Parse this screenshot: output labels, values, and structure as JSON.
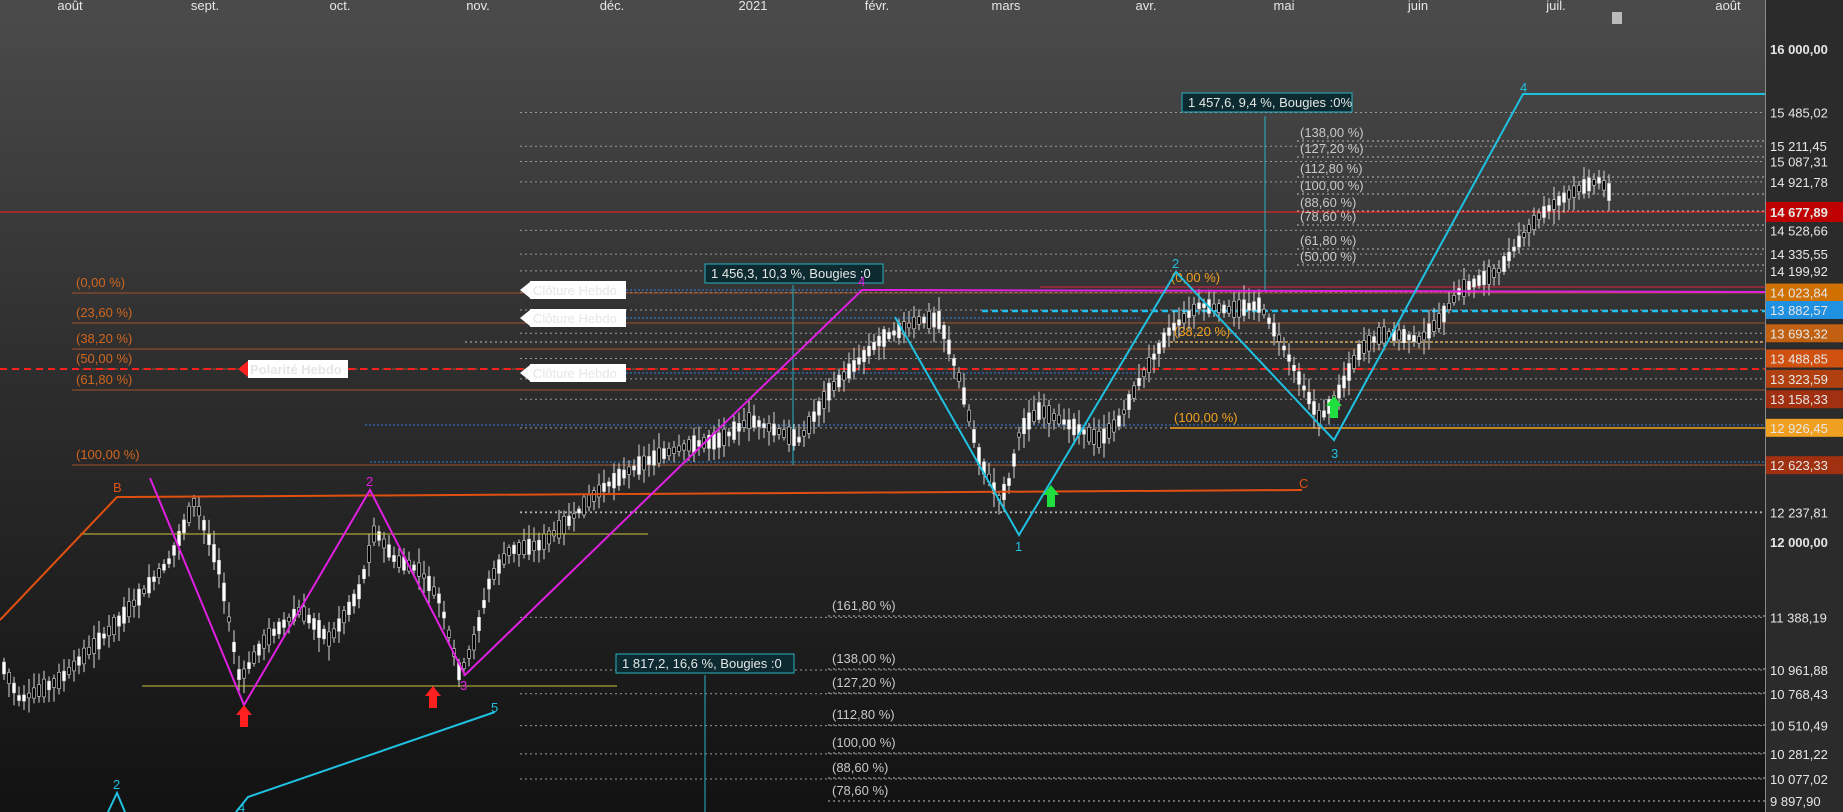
{
  "chart_data": {
    "type": "candlestick",
    "x_ticks": [
      "août",
      "sept.",
      "oct.",
      "nov.",
      "déc.",
      "2021",
      "févr.",
      "mars",
      "avr.",
      "mai",
      "juin",
      "juil.",
      "août"
    ],
    "price_axis_labels": [
      "16 000,00",
      "15 485,02",
      "15 211,45",
      "15 087,31",
      "14 921,78",
      "14 528,66",
      "14 335,55",
      "14 199,92",
      "14 023,84",
      "13 882,57",
      "13 693,32",
      "13 488,85",
      "13 323,59",
      "13 158,33",
      "12 926,45",
      "12 623,33",
      "12 237,81",
      "12 000,00",
      "11 388,19",
      "10 961,88",
      "10 768,43",
      "10 510,49",
      "10 281,22",
      "10 077,02",
      "9 897,90"
    ],
    "current_price": "14 677,89",
    "weekly_close_label": "Clôture Hebdo",
    "weekly_polarity_label": "Polarité Hebdo",
    "measures": [
      "1 457,6, 9,4 %, Bougies :0%",
      "1 456,3, 10,3 %, Bougies :0",
      "1 817,2, 16,6 %, Bougies :0"
    ],
    "fib_left": [
      "(0,00 %)",
      "(23,60 %)",
      "(38,20 %)",
      "(50,00 %)",
      "(61,80 %)",
      "(100,00 %)"
    ],
    "fib_right_upper": [
      "(138,00 %)",
      "(127,20 %)",
      "(112,80 %)",
      "(100,00 %)",
      "(88,60 %)",
      "(78,60 %)",
      "(61,80 %)",
      "(50,00 %)"
    ],
    "fib_retr": [
      "(0,00 %)",
      "(38,20 %)",
      "(100,00 %)"
    ],
    "fib_lower": [
      "(161,80 %)",
      "(138,00 %)",
      "(127,20 %)",
      "(112,80 %)",
      "(100,00 %)",
      "(88,60 %)",
      "(78,60 %)"
    ],
    "wave_labels": {
      "magenta": [
        "2",
        "3",
        "4",
        "2"
      ],
      "cyan": [
        "1",
        "2",
        "3",
        "4",
        "5",
        "2",
        "4"
      ],
      "orange": [
        "B",
        "C"
      ]
    },
    "colors": {
      "up": "#ffffff",
      "down": "#000000",
      "magenta": "#e020e0",
      "cyan": "#20c0e0",
      "orange": "#e05010",
      "price_line": "#ff2020"
    }
  }
}
